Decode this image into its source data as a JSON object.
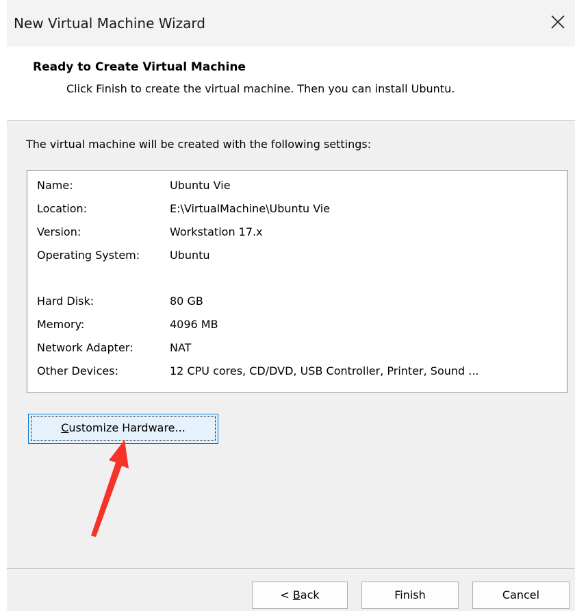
{
  "window": {
    "title": "New Virtual Machine Wizard",
    "close_icon": "close-icon"
  },
  "header": {
    "title": "Ready to Create Virtual Machine",
    "subtitle": "Click Finish to create the virtual machine. Then you can install Ubuntu."
  },
  "intro": "The virtual machine will be created with the following settings:",
  "settings": [
    {
      "label": "Name:",
      "value": "Ubuntu Vie"
    },
    {
      "label": "Location:",
      "value": "E:\\VirtualMachine\\Ubuntu Vie"
    },
    {
      "label": "Version:",
      "value": "Workstation 17.x"
    },
    {
      "label": "Operating System:",
      "value": "Ubuntu"
    },
    {
      "label": "Hard Disk:",
      "value": "80 GB"
    },
    {
      "label": "Memory:",
      "value": "4096 MB"
    },
    {
      "label": "Network Adapter:",
      "value": "NAT"
    },
    {
      "label": "Other Devices:",
      "value": "12 CPU cores, CD/DVD, USB Controller, Printer, Sound ..."
    }
  ],
  "customize_button": {
    "mnemonic": "C",
    "rest": "ustomize Hardware..."
  },
  "footer": {
    "back": {
      "prefix": "< ",
      "mnemonic": "B",
      "rest": "ack"
    },
    "finish": "Finish",
    "cancel": "Cancel"
  },
  "colors": {
    "annotation_arrow": "#f5332b",
    "focus_border": "#0078d7"
  }
}
